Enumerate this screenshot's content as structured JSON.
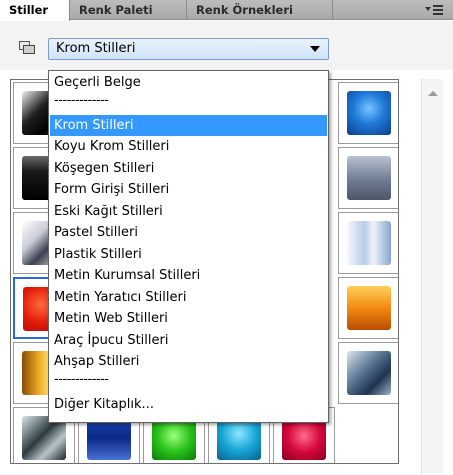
{
  "tabs": [
    {
      "label": "Stiller",
      "active": true
    },
    {
      "label": "Renk Paleti",
      "active": false
    },
    {
      "label": "Renk Örnekleri",
      "active": false
    }
  ],
  "combo": {
    "value": "Krom Stilleri"
  },
  "dropdown": {
    "items": [
      {
        "label": "Geçerli Belge"
      },
      {
        "label": "-------------",
        "separator": true
      },
      {
        "label": "Krom Stilleri",
        "selected": true
      },
      {
        "label": "Koyu Krom Stilleri"
      },
      {
        "label": "Köşegen Stilleri"
      },
      {
        "label": "Form Girişi Stilleri"
      },
      {
        "label": "Eski Kağıt Stilleri"
      },
      {
        "label": "Pastel Stilleri"
      },
      {
        "label": "Plastik Stilleri"
      },
      {
        "label": "Metin Kurumsal Stilleri"
      },
      {
        "label": "Metin Yaratıcı Stilleri"
      },
      {
        "label": "Metin Web Stilleri"
      },
      {
        "label": "Araç İpucu Stilleri"
      },
      {
        "label": "Ahşap Stilleri"
      },
      {
        "label": "-------------",
        "separator": true
      },
      {
        "label": "Diğer Kitaplık..."
      }
    ]
  },
  "colors": {
    "selection": "#3399ff",
    "tabbar": "#b4b4b4",
    "combo_border": "#7a9cc9"
  },
  "icons": [
    "panel-menu-icon",
    "style-library-icon",
    "chevron-down-icon"
  ],
  "swatches": [
    {
      "name": "style-swatch-black-glossy",
      "fill": "linear-gradient(135deg,#f2f2f2 0%,#202020 40%,#000 70%,#4a4a4a 100%)"
    },
    {
      "name": "style-swatch-blue-square",
      "fill": "radial-gradient(circle at 50% 40%,#7ac4ff 0%,#1f7ad8 45%,#0c3f8a 100%)"
    },
    {
      "name": "style-swatch-black-button",
      "fill": "linear-gradient(#6a6a6a 0%,#1a1a1a 35%,#000 100%)"
    },
    {
      "name": "style-swatch-steel-gray",
      "fill": "linear-gradient(#b9c1d0 0%,#6f7b91 55%,#4b566a 100%)"
    },
    {
      "name": "style-swatch-silver-frame",
      "fill": "linear-gradient(135deg,#ffffff 0%,#c9ccd6 35%,#3c4050 60%,#f0f0f0 100%)"
    },
    {
      "name": "style-swatch-pale-blue",
      "fill": "linear-gradient(90deg,#f6f9ff 0%,#b7cbe6 40%,#eef3fb 60%,#8aa6cf 100%)"
    },
    {
      "name": "style-swatch-red",
      "fill": "radial-gradient(circle at 40% 40%,#ff6a3a 0%,#e31a0a 50%,#a80800 100%)"
    },
    {
      "name": "style-swatch-orange",
      "fill": "linear-gradient(#ffcf5a 0%,#f38a10 50%,#b94c00 100%)"
    },
    {
      "name": "style-swatch-gold",
      "fill": "linear-gradient(90deg,#8a4c05 0%,#f0b028 40%,#ffd66a 60%,#b86a08 100%)"
    },
    {
      "name": "style-swatch-dark-steel",
      "fill": "linear-gradient(135deg,#dfe6ef 0%,#5d7a97 40%,#1e3350 70%,#9fb2c8 100%)"
    },
    {
      "name": "style-swatch-photo",
      "fill": "linear-gradient(135deg,#dde6ea 0%,#2c3a40 45%,#b8c4c8 70%,#1d262b 100%)"
    },
    {
      "name": "style-swatch-navy-frame",
      "fill": "linear-gradient(#1f46b8 0%,#0a2a86 50%,#4a6fd8 100%)"
    },
    {
      "name": "style-swatch-green",
      "fill": "radial-gradient(circle at 50% 45%,#9cff7a 0%,#29c21a 50%,#0a7a0a 100%)"
    },
    {
      "name": "style-swatch-teal",
      "fill": "radial-gradient(circle at 50% 40%,#8fe6ff 0%,#16a6d6 50%,#0a5f8a 100%)"
    },
    {
      "name": "style-swatch-crimson",
      "fill": "radial-gradient(circle at 50% 45%,#ff6a8a 0%,#d4083a 50%,#8a0020 100%)"
    }
  ]
}
